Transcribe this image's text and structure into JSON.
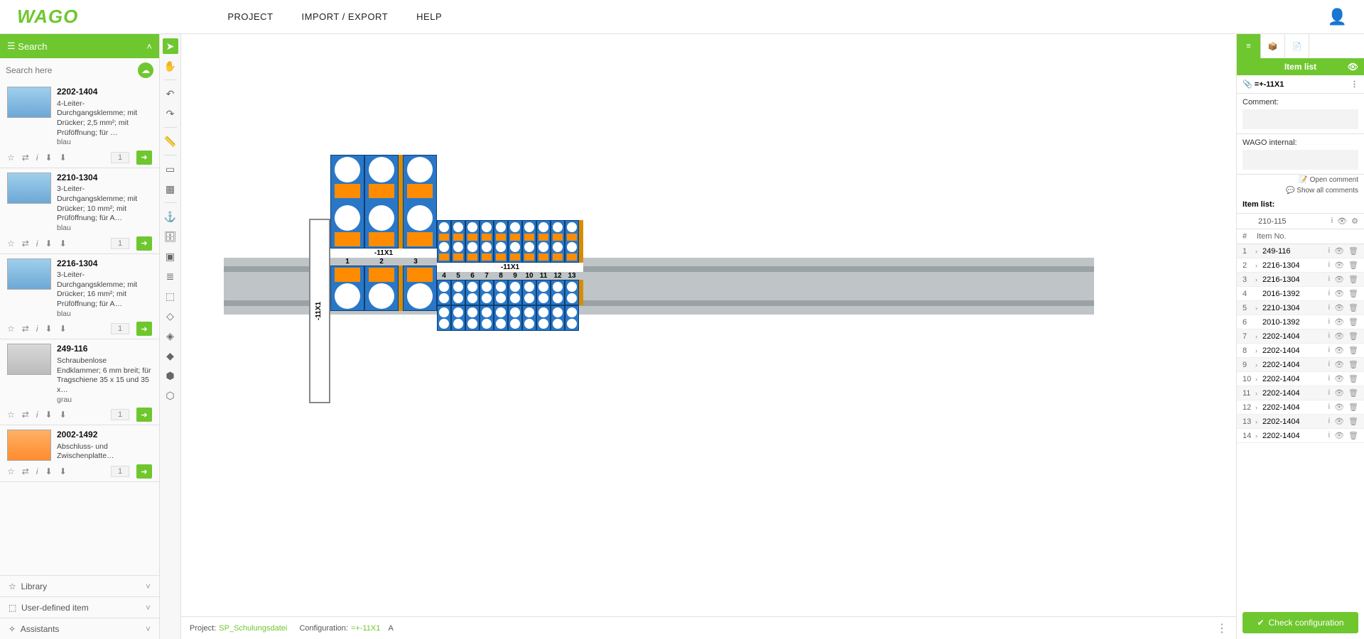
{
  "app": {
    "logo": "WAGO"
  },
  "menu": {
    "project": "PROJECT",
    "import_export": "IMPORT / EXPORT",
    "help": "HELP"
  },
  "sidebar": {
    "search_title": "Search",
    "search_placeholder": "Search here",
    "items": [
      {
        "sku": "2202-1404",
        "desc": "4-Leiter-Durchgangsklemme; mit Drücker; 2,5 mm²; mit Prüföffnung; für …",
        "color": "blau",
        "qty": "1",
        "thumb": "blue"
      },
      {
        "sku": "2210-1304",
        "desc": "3-Leiter-Durchgangsklemme; mit Drücker; 10 mm²; mit Prüföffnung; für A…",
        "color": "blau",
        "qty": "1",
        "thumb": "blue"
      },
      {
        "sku": "2216-1304",
        "desc": "3-Leiter-Durchgangsklemme; mit Drücker; 16 mm²; mit Prüföffnung; für A…",
        "color": "blau",
        "qty": "1",
        "thumb": "blue"
      },
      {
        "sku": "249-116",
        "desc": "Schraubenlose Endklammer; 6 mm breit; für Tragschiene 35 x 15 und 35 x…",
        "color": "grau",
        "qty": "1",
        "thumb": "grey"
      },
      {
        "sku": "2002-1492",
        "desc": "Abschluss- und Zwischenplatte…",
        "color": "",
        "qty": "1",
        "thumb": "orange"
      }
    ],
    "footer": {
      "library": "Library",
      "userdef": "User-defined item",
      "assistants": "Assistants"
    }
  },
  "tools": [
    {
      "name": "pointer-icon",
      "glyph": "➤",
      "active": true
    },
    {
      "name": "hand-icon",
      "glyph": "✋"
    },
    {
      "name": "sep"
    },
    {
      "name": "undo-icon",
      "glyph": "↶"
    },
    {
      "name": "redo-icon",
      "glyph": "↷"
    },
    {
      "name": "sep"
    },
    {
      "name": "ruler-icon",
      "glyph": "📏"
    },
    {
      "name": "sep"
    },
    {
      "name": "rail-icon",
      "glyph": "▭"
    },
    {
      "name": "grid-icon",
      "glyph": "▦"
    },
    {
      "name": "sep"
    },
    {
      "name": "anchor-icon",
      "glyph": "⚓"
    },
    {
      "name": "cylinder-icon",
      "glyph": "🗄"
    },
    {
      "name": "module-icon",
      "glyph": "▣"
    },
    {
      "name": "layers-icon",
      "glyph": "≣"
    },
    {
      "name": "cube1-icon",
      "glyph": "⬚"
    },
    {
      "name": "cube2-icon",
      "glyph": "◇"
    },
    {
      "name": "cube3-icon",
      "glyph": "◈"
    },
    {
      "name": "cube4-icon",
      "glyph": "◆"
    },
    {
      "name": "cube5-icon",
      "glyph": "⬢"
    },
    {
      "name": "cube6-icon",
      "glyph": "⬡"
    }
  ],
  "canvas": {
    "endplate_label": "-11X1",
    "mark_big": "-11X1",
    "nums_big": [
      "1",
      "2",
      "3"
    ],
    "mark_small": "-11X1",
    "nums_small": [
      "4",
      "5",
      "6",
      "7",
      "8",
      "9",
      "10",
      "11",
      "12",
      "13"
    ]
  },
  "status": {
    "project_lbl": "Project:",
    "project_val": "SP_Schulungsdatei",
    "config_lbl": "Configuration:",
    "config_val": "=+-11X1",
    "suffix": "A"
  },
  "right": {
    "tabs": {
      "list": "≡",
      "pkg": "📦",
      "doc": "📄"
    },
    "title": "Item list",
    "rail_tag": "📎",
    "rail_name": "=+-11X1",
    "comment_lbl": "Comment:",
    "internal_lbl": "WAGO internal:",
    "open_comment": "📝 Open comment",
    "show_all": "💬 Show all comments",
    "itemlist_lbl": "Item list:",
    "current_item": "210-115",
    "cols": {
      "hash": "#",
      "item": "Item No."
    },
    "rows": [
      {
        "n": "1",
        "exp": true,
        "item": "249-116"
      },
      {
        "n": "2",
        "exp": true,
        "item": "2216-1304"
      },
      {
        "n": "3",
        "exp": true,
        "item": "2216-1304"
      },
      {
        "n": "4",
        "exp": false,
        "item": "2016-1392"
      },
      {
        "n": "5",
        "exp": true,
        "item": "2210-1304"
      },
      {
        "n": "6",
        "exp": false,
        "item": "2010-1392"
      },
      {
        "n": "7",
        "exp": true,
        "item": "2202-1404"
      },
      {
        "n": "8",
        "exp": true,
        "item": "2202-1404"
      },
      {
        "n": "9",
        "exp": true,
        "item": "2202-1404"
      },
      {
        "n": "10",
        "exp": true,
        "item": "2202-1404"
      },
      {
        "n": "11",
        "exp": true,
        "item": "2202-1404"
      },
      {
        "n": "12",
        "exp": true,
        "item": "2202-1404"
      },
      {
        "n": "13",
        "exp": true,
        "item": "2202-1404"
      },
      {
        "n": "14",
        "exp": true,
        "item": "2202-1404"
      }
    ],
    "check_btn": "Check configuration"
  }
}
